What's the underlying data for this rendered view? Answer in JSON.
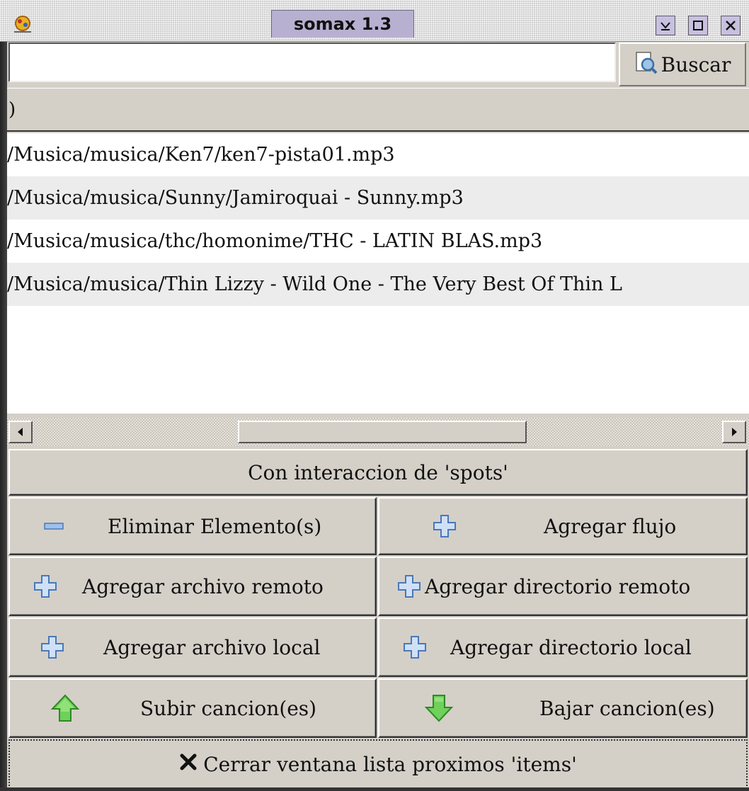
{
  "window": {
    "title": "somax 1.3",
    "controls": {
      "minimize_icon": "minimize-icon",
      "maximize_icon": "maximize-icon",
      "close_icon": "close-icon"
    }
  },
  "search": {
    "value": "",
    "button_label": "Buscar",
    "button_icon": "magnifier-icon"
  },
  "list": {
    "header": ")",
    "items": [
      "/Musica/musica/Ken7/ken7-pista01.mp3",
      "/Musica/musica/Sunny/Jamiroquai - Sunny.mp3",
      "/Musica/musica/thc/homonime/THC - LATIN BLAS.mp3",
      "/Musica/musica/Thin Lizzy - Wild One - The Very Best Of Thin L"
    ]
  },
  "scrollbar": {
    "left_icon": "arrow-left-icon",
    "right_icon": "arrow-right-icon"
  },
  "actions": {
    "spots": "Con interaccion de 'spots'",
    "remove": "Eliminar Elemento(s)",
    "add_stream": "Agregar flujo",
    "add_remote_file": "Agregar archivo remoto",
    "add_remote_dir": "Agregar directorio remoto",
    "add_local_file": "Agregar archivo local",
    "add_local_dir": "Agregar directorio local",
    "move_up": "Subir cancion(es)",
    "move_down": "Bajar cancion(es)",
    "close_window": "Cerrar ventana lista proximos 'items'"
  },
  "colors": {
    "plus_blue": "#5a86c8",
    "arrow_green": "#3aa630",
    "title_tab": "#b8b0d0"
  }
}
